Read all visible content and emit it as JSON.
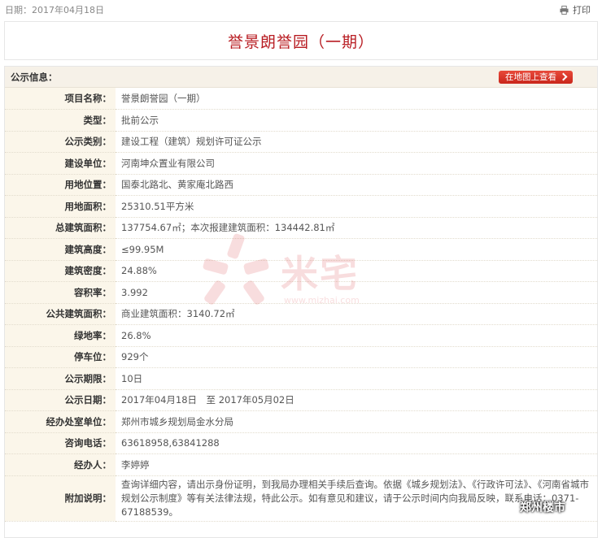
{
  "header": {
    "date_text": "日期：2017年04月18日",
    "print_label": "打印"
  },
  "title": "誉景朗誉园（一期）",
  "section": {
    "title": "公示信息：",
    "map_button_label": "在地图上查看"
  },
  "rows": [
    {
      "label": "项目名称：",
      "value": "誉景朗誉园（一期）"
    },
    {
      "label": "类型：",
      "value": "批前公示"
    },
    {
      "label": "公示类别：",
      "value": "建设工程（建筑）规划许可证公示"
    },
    {
      "label": "建设单位：",
      "value": "河南坤众置业有限公司"
    },
    {
      "label": "用地位置：",
      "value": "国泰北路北、黄家庵北路西"
    },
    {
      "label": "用地面积：",
      "value": "25310.51平方米"
    },
    {
      "label": "总建筑面积：",
      "value": "137754.67㎡；本次报建建筑面积：134442.81㎡"
    },
    {
      "label": "建筑高度：",
      "value": "≤99.95M"
    },
    {
      "label": "建筑密度：",
      "value": "24.88%"
    },
    {
      "label": "容积率：",
      "value": "3.992"
    },
    {
      "label": "公共建筑面积：",
      "value": "商业建筑面积：3140.72㎡"
    },
    {
      "label": "绿地率：",
      "value": "26.8%"
    },
    {
      "label": "停车位：",
      "value": "929个"
    },
    {
      "label": "公示期限：",
      "value": "10日"
    },
    {
      "label": "公示日期：",
      "value": "2017年04月18日　至 2017年05月02日"
    },
    {
      "label": "经办处室单位：",
      "value": "郑州市城乡规划局金水分局"
    },
    {
      "label": "咨询电话：",
      "value": "63618958,63841288"
    },
    {
      "label": "经办人：",
      "value": "李婷婷"
    },
    {
      "label": "附加说明：",
      "value": "查询详细内容，请出示身份证明，到我局办理相关手续后查询。依据《城乡规划法》、《行政许可法》、《河南省城市规划公示制度》等有关法律法规，特此公示。如有意见和建议，请于公示时间内向我局反映，联系电话：0371-67188539。"
    }
  ],
  "watermark": {
    "text": "米宅",
    "url": "www.mizhai.com"
  },
  "stamp_text": "郑州楼市",
  "colors": {
    "title_red": "#b81c22",
    "button_red": "#d83224",
    "label_bg": "#fbf6ea"
  }
}
